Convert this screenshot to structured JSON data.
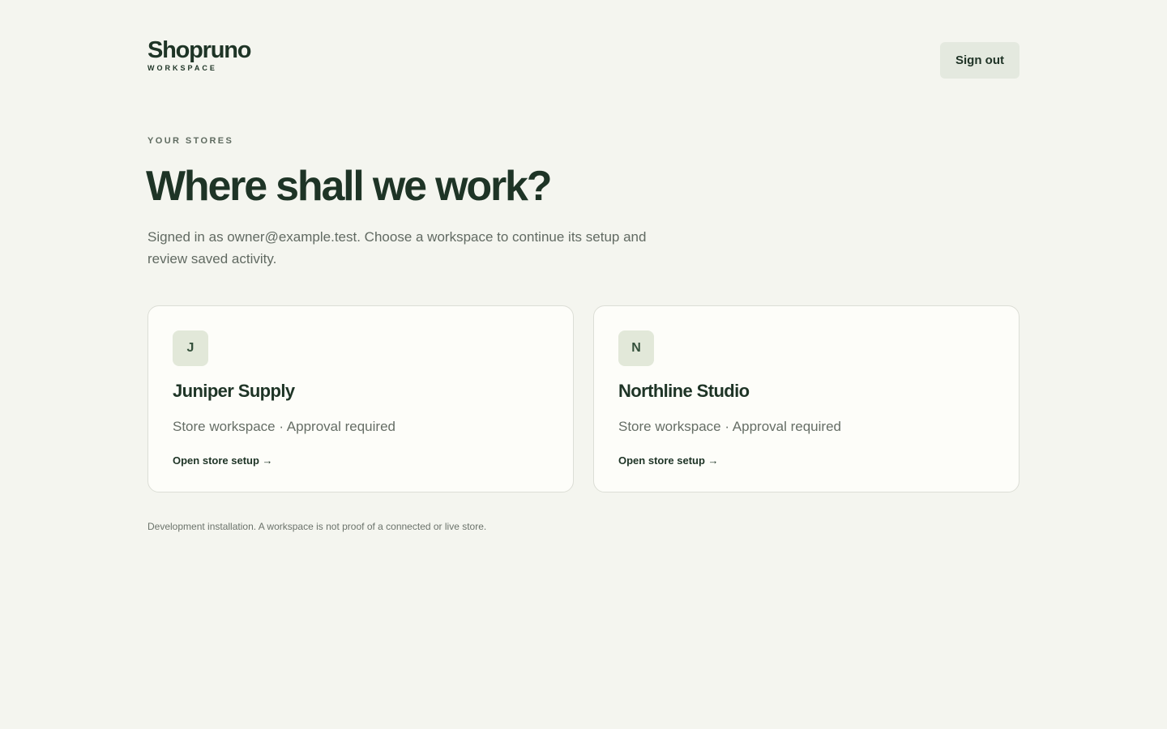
{
  "brand": {
    "name": "Shopruno",
    "subtitle": "WORKSPACE"
  },
  "header": {
    "signout_label": "Sign out"
  },
  "main": {
    "eyebrow": "YOUR STORES",
    "title": "Where shall we work?",
    "intro": "Signed in as owner@example.test. Choose a workspace to continue its setup and review saved activity."
  },
  "stores": [
    {
      "initial": "J",
      "name": "Juniper Supply",
      "meta": "Store workspace · Approval required",
      "link": "Open store setup →"
    },
    {
      "initial": "N",
      "name": "Northline Studio",
      "meta": "Store workspace · Approval required",
      "link": "Open store setup →"
    }
  ],
  "footer": {
    "note": "Development installation. A workspace is not proof of a connected or live store."
  },
  "colors": {
    "background": "#f4f5ef",
    "text_primary": "#1e3426",
    "card_background": "#fdfdf9",
    "avatar_background": "#e2e8d9",
    "button_background": "#e4e9df"
  }
}
